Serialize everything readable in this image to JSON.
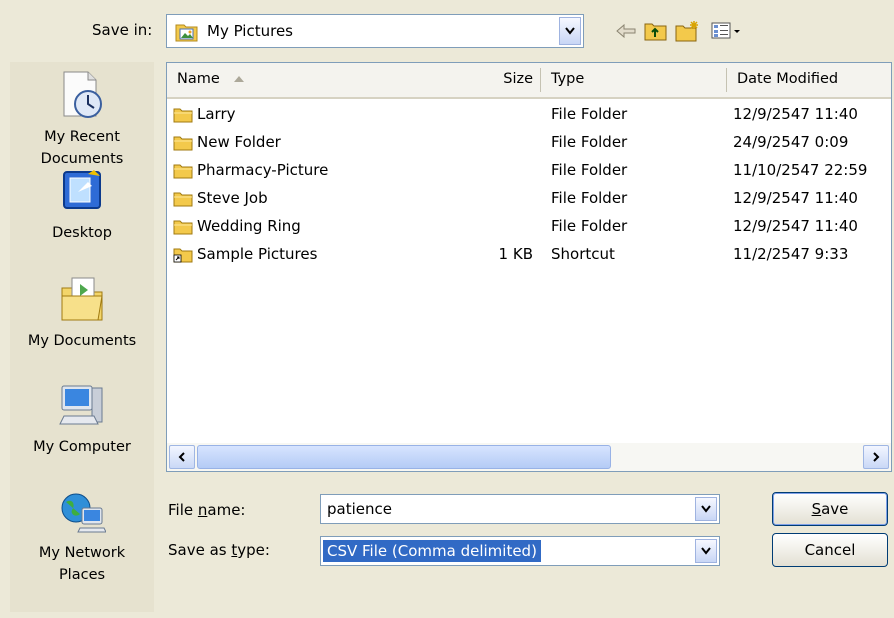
{
  "toolbar": {
    "save_in_label": "Save in:",
    "location_value": "My Pictures"
  },
  "places": [
    {
      "label_line1": "My Recent",
      "label_line2": "Documents",
      "icon": "recent-documents-icon"
    },
    {
      "label_line1": "Desktop",
      "label_line2": "",
      "icon": "desktop-icon"
    },
    {
      "label_line1": "My Documents",
      "label_line2": "",
      "icon": "my-documents-icon"
    },
    {
      "label_line1": "My Computer",
      "label_line2": "",
      "icon": "my-computer-icon"
    },
    {
      "label_line1": "My Network",
      "label_line2": "Places",
      "icon": "network-places-icon"
    }
  ],
  "list": {
    "columns": {
      "name": "Name",
      "size": "Size",
      "type": "Type",
      "date": "Date Modified"
    },
    "rows": [
      {
        "name": "Larry",
        "size": "",
        "type": "File Folder",
        "date": "12/9/2547 11:40",
        "icon": "folder-icon"
      },
      {
        "name": "New Folder",
        "size": "",
        "type": "File Folder",
        "date": "24/9/2547 0:09",
        "icon": "folder-icon"
      },
      {
        "name": "Pharmacy-Picture",
        "size": "",
        "type": "File Folder",
        "date": "11/10/2547 22:59",
        "icon": "folder-icon"
      },
      {
        "name": "Steve Job",
        "size": "",
        "type": "File Folder",
        "date": "12/9/2547 11:40",
        "icon": "folder-icon"
      },
      {
        "name": "Wedding Ring",
        "size": "",
        "type": "File Folder",
        "date": "12/9/2547 11:40",
        "icon": "folder-icon"
      },
      {
        "name": "Sample Pictures",
        "size": "1 KB",
        "type": "Shortcut",
        "date": "11/2/2547 9:33",
        "icon": "shortcut-folder-icon"
      }
    ]
  },
  "form": {
    "file_name_label_pre": "File ",
    "file_name_label_u": "n",
    "file_name_label_post": "ame:",
    "file_name_value": "patience",
    "save_type_label_pre": "Save as ",
    "save_type_label_u": "t",
    "save_type_label_post": "ype:",
    "save_type_value": "CSV File (Comma delimited)"
  },
  "buttons": {
    "save_u": "S",
    "save_rest": "ave",
    "cancel": "Cancel"
  }
}
